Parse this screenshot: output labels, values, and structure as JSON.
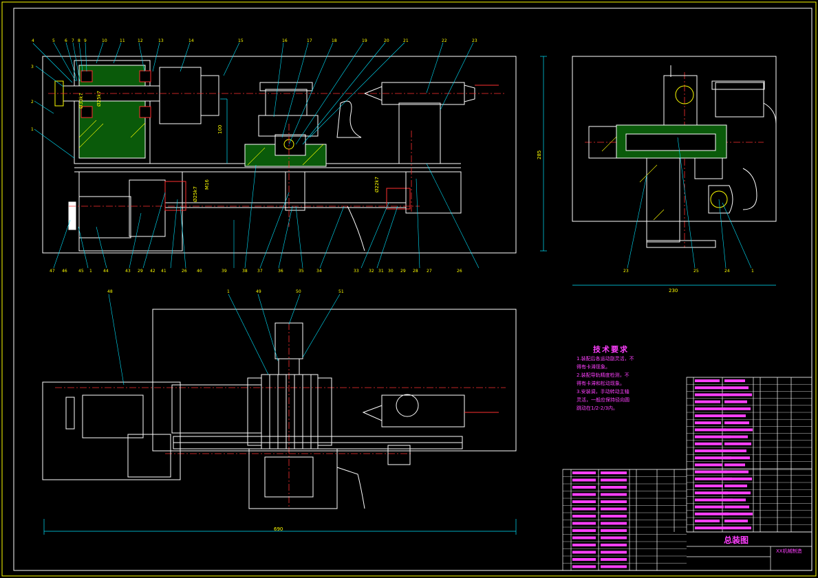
{
  "drawing": {
    "title": "总装图",
    "school": "XX机械制造",
    "tech_requirements": {
      "heading": "技术要求",
      "lines": [
        "1.装配后各运动副灵活，不",
        "得有卡滞现象。",
        "2.装配导轨精度检测，不",
        "得有卡滞和松动现象。",
        "3.安装调，手动转动主轴",
        "灵活，一般应保持径向圆",
        "跳动在1/2-2/3内。"
      ]
    },
    "dimensions": {
      "height_main": "100",
      "dia_a": "Ø30k7",
      "dia_b": "Ø25k7",
      "dia_c": "M16",
      "dia_d": "Ø25k7",
      "dia_e": "Ø22k7",
      "side_height": "285",
      "side_width": "230",
      "total_length": "690"
    },
    "balloons_top": [
      "4",
      "5",
      "6",
      "7",
      "8",
      "9",
      "10",
      "11",
      "12",
      "13",
      "14",
      "15",
      "16",
      "17",
      "18",
      "19",
      "20",
      "21",
      "22",
      "23"
    ],
    "balloons_left": [
      "3",
      "2",
      "1"
    ],
    "balloons_bottom": [
      "47",
      "46",
      "45",
      "1",
      "44",
      "43",
      "29",
      "42",
      "41",
      "26",
      "40",
      "39",
      "38",
      "37",
      "36",
      "35",
      "34",
      "33",
      "32",
      "31",
      "30",
      "29",
      "28",
      "27",
      "26"
    ],
    "balloons_side": [
      "23",
      "25",
      "24",
      "1"
    ],
    "balloons_plan": [
      "48",
      "1",
      "49",
      "50",
      "51"
    ]
  }
}
